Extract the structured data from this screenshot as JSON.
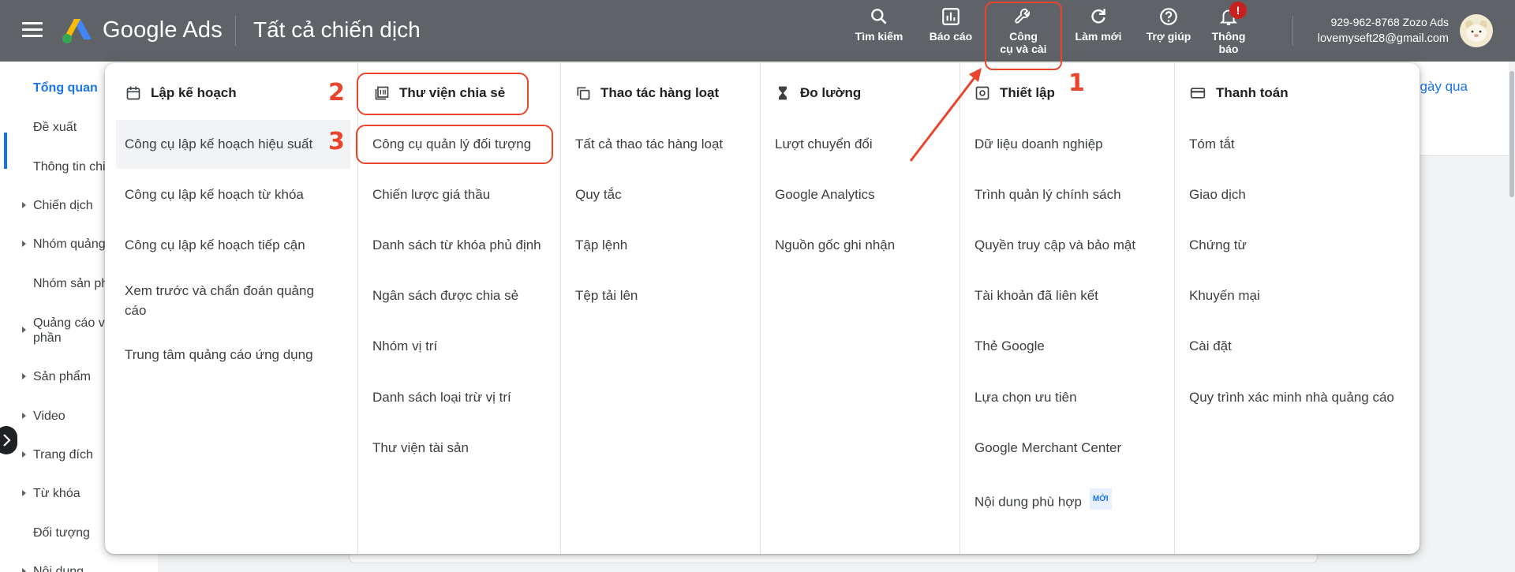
{
  "app": {
    "brand": "Google Ads",
    "page_title": "Tất cả chiến dịch"
  },
  "toolbar": [
    {
      "label": "Tìm kiếm",
      "icon": "search-icon"
    },
    {
      "label": "Báo cáo",
      "icon": "reports-icon"
    },
    {
      "label": "Công\ncụ và cài",
      "icon": "wrench-icon"
    },
    {
      "label": "Làm mới",
      "icon": "refresh-icon"
    },
    {
      "label": "Trợ giúp",
      "icon": "help-icon"
    },
    {
      "label": "Thông\nbáo",
      "icon": "bell-icon",
      "badge": "!"
    }
  ],
  "account": {
    "phone_name": "929-962-8768 Zozo Ads",
    "email": "lovemyseft28@gmail.com"
  },
  "sidebar": {
    "items": [
      {
        "label": "Tổng quan",
        "active": true,
        "expandable": false
      },
      {
        "label": "Đề xuất",
        "expandable": false
      },
      {
        "label": "Thông tin chi",
        "expandable": false
      },
      {
        "label": "Chiến dịch",
        "expandable": true
      },
      {
        "label": "Nhóm quảng",
        "expandable": true
      },
      {
        "label": "Nhóm sản ph",
        "expandable": false
      },
      {
        "label": "Quảng cáo và\nphần",
        "expandable": true
      },
      {
        "label": "Sản phẩm",
        "expandable": true
      },
      {
        "label": "Video",
        "expandable": true
      },
      {
        "label": "Trang đích",
        "expandable": true
      },
      {
        "label": "Từ khóa",
        "expandable": true
      },
      {
        "label": "Đối tượng",
        "expandable": false
      },
      {
        "label": "Nội dung",
        "expandable": true
      }
    ]
  },
  "background": {
    "date_link": "ngày qua"
  },
  "menu": {
    "columns": [
      {
        "heading": "Lập kế hoạch",
        "icon": "calendar-icon",
        "items": [
          "Công cụ lập kế hoạch hiệu suất",
          "Công cụ lập kế hoạch từ khóa",
          "Công cụ lập kế hoạch tiếp cận",
          "Xem trước và chẩn đoán quảng cáo",
          "Trung tâm quảng cáo ứng dụng"
        ]
      },
      {
        "heading": "Thư viện chia sẻ",
        "icon": "library-icon",
        "items": [
          "Công cụ quản lý đối tượng",
          "Chiến lược giá thầu",
          "Danh sách từ khóa phủ định",
          "Ngân sách được chia sẻ",
          "Nhóm vị trí",
          "Danh sách loại trừ vị trí",
          "Thư viện tài sản"
        ]
      },
      {
        "heading": "Thao tác hàng loạt",
        "icon": "copy-icon",
        "items": [
          "Tất cả thao tác hàng loạt",
          "Quy tắc",
          "Tập lệnh",
          "Tệp tải lên"
        ]
      },
      {
        "heading": "Đo lường",
        "icon": "hourglass-icon",
        "items": [
          "Lượt chuyển đổi",
          "Google Analytics",
          "Nguồn gốc ghi nhận"
        ]
      },
      {
        "heading": "Thiết lập",
        "icon": "settings-icon",
        "items": [
          "Dữ liệu doanh nghiệp",
          "Trình quản lý chính sách",
          "Quyền truy cập và bảo mật",
          "Tài khoản đã liên kết",
          "Thẻ Google",
          "Lựa chọn ưu tiên",
          "Google Merchant Center",
          "Nội dung phù hợp"
        ],
        "new_badge": "MỚI"
      },
      {
        "heading": "Thanh toán",
        "icon": "credit-card-icon",
        "items": [
          "Tóm tắt",
          "Giao dịch",
          "Chứng từ",
          "Khuyến mại",
          "Cài đặt",
          "Quy trình xác minh nhà quảng cáo"
        ]
      }
    ]
  },
  "annotations": {
    "n1": "1",
    "n2": "2",
    "n3": "3"
  },
  "colors": {
    "topbar": "#5f6368",
    "accent": "#1a73e8",
    "annotation": "#e8452c"
  }
}
